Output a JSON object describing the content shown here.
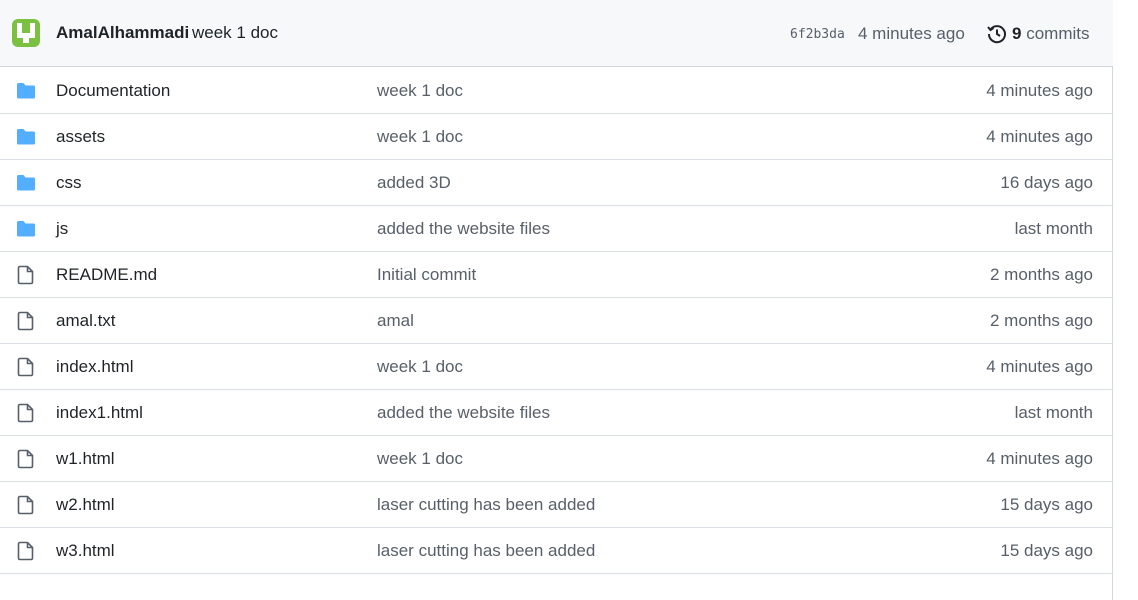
{
  "header": {
    "author": "AmalAlhammadi",
    "commit_message": "week 1 doc",
    "sha": "6f2b3da",
    "time": "4 minutes ago",
    "commit_count": "9",
    "commit_label": "commits"
  },
  "files": [
    {
      "type": "folder",
      "name": "Documentation",
      "message": "week 1 doc",
      "time": "4 minutes ago"
    },
    {
      "type": "folder",
      "name": "assets",
      "message": "week 1 doc",
      "time": "4 minutes ago"
    },
    {
      "type": "folder",
      "name": "css",
      "message": "added 3D",
      "time": "16 days ago"
    },
    {
      "type": "folder",
      "name": "js",
      "message": "added the website files",
      "time": "last month"
    },
    {
      "type": "file",
      "name": "README.md",
      "message": "Initial commit",
      "time": "2 months ago"
    },
    {
      "type": "file",
      "name": "amal.txt",
      "message": "amal",
      "time": "2 months ago"
    },
    {
      "type": "file",
      "name": "index.html",
      "message": "week 1 doc",
      "time": "4 minutes ago"
    },
    {
      "type": "file",
      "name": "index1.html",
      "message": "added the website files",
      "time": "last month"
    },
    {
      "type": "file",
      "name": "w1.html",
      "message": "week 1 doc",
      "time": "4 minutes ago"
    },
    {
      "type": "file",
      "name": "w2.html",
      "message": "laser cutting has been added",
      "time": "15 days ago"
    },
    {
      "type": "file",
      "name": "w3.html",
      "message": "laser cutting has been added",
      "time": "15 days ago"
    }
  ],
  "colors": {
    "folder": "#54aeff",
    "file_icon": "#57606a",
    "avatar": "#7ac142"
  }
}
